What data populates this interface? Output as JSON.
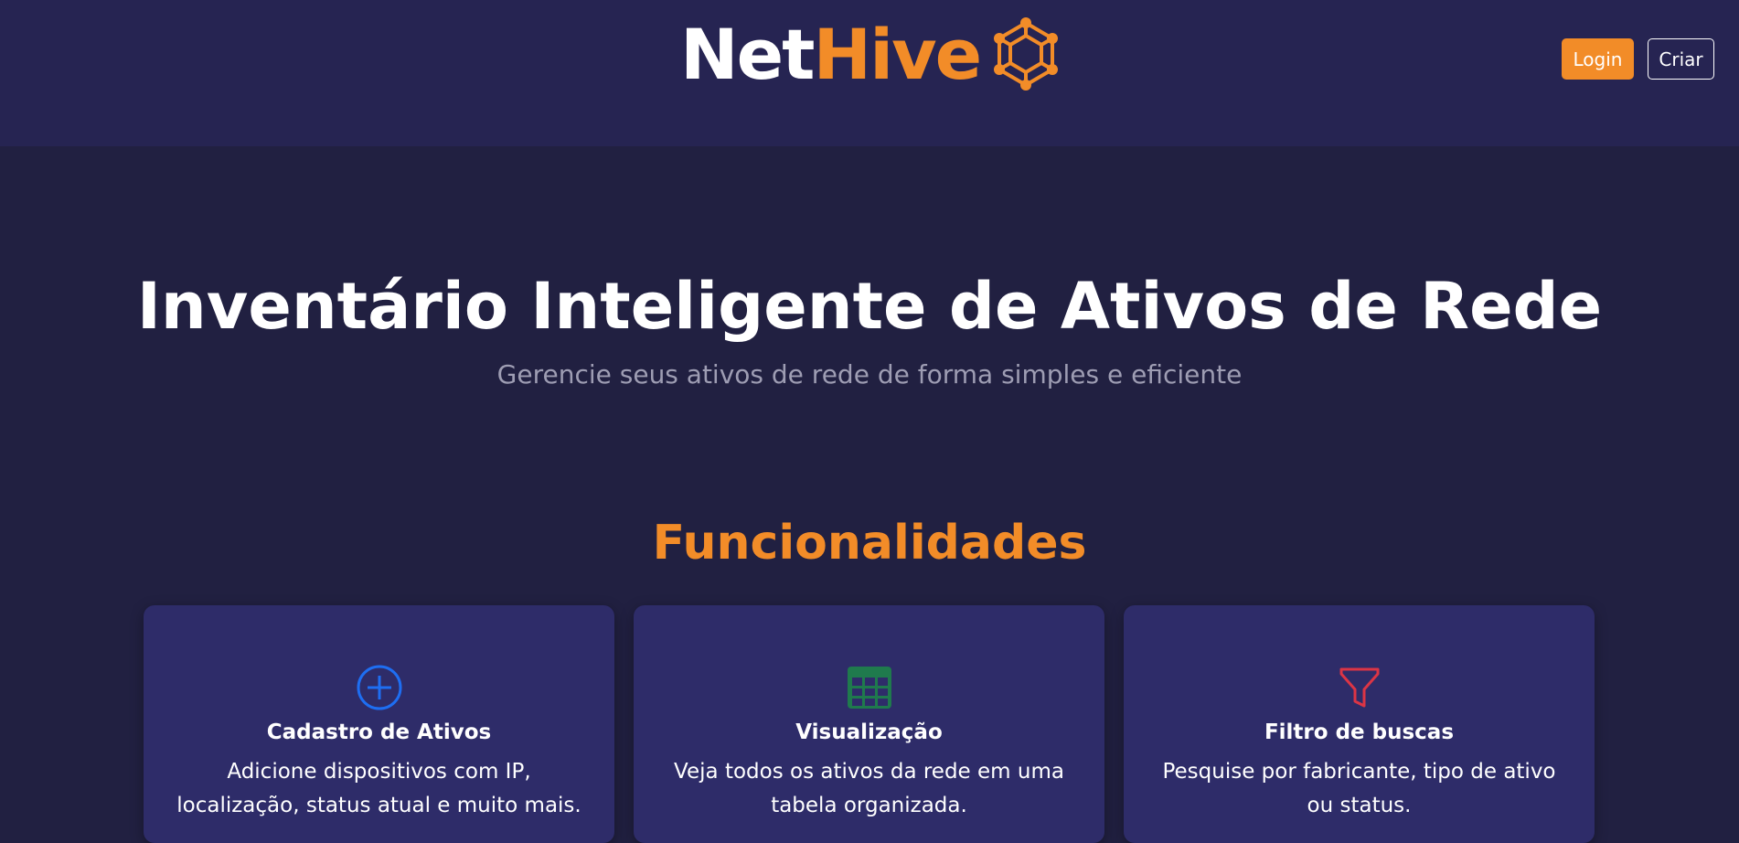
{
  "header": {
    "logo_part1": "Net",
    "logo_part2": "Hive",
    "logo_icon": "hexagon-network-icon",
    "login_label": "Login",
    "criar_label": "Criar"
  },
  "hero": {
    "title": "Inventário Inteligente de Ativos de Rede",
    "subtitle": "Gerencie seus ativos de rede de forma simples e eficiente"
  },
  "features": {
    "section_title": "Funcionalidades",
    "cards": [
      {
        "icon": "plus-circle-icon",
        "title": "Cadastro de Ativos",
        "text": "Adicione dispositivos com IP, localização, status atual e muito mais."
      },
      {
        "icon": "table-icon",
        "title": "Visualização",
        "text": "Veja todos os ativos da rede em uma tabela organizada."
      },
      {
        "icon": "filter-icon",
        "title": "Filtro de buscas",
        "text": "Pesquise por fabricante, tipo de ativo ou status."
      }
    ]
  },
  "colors": {
    "background": "#212041",
    "header": "#262452",
    "card": "#2e2c69",
    "accent": "#f28c28",
    "icon_blue": "#1e6ef2",
    "icon_green": "#1f7a4d",
    "icon_red": "#dc3545"
  }
}
